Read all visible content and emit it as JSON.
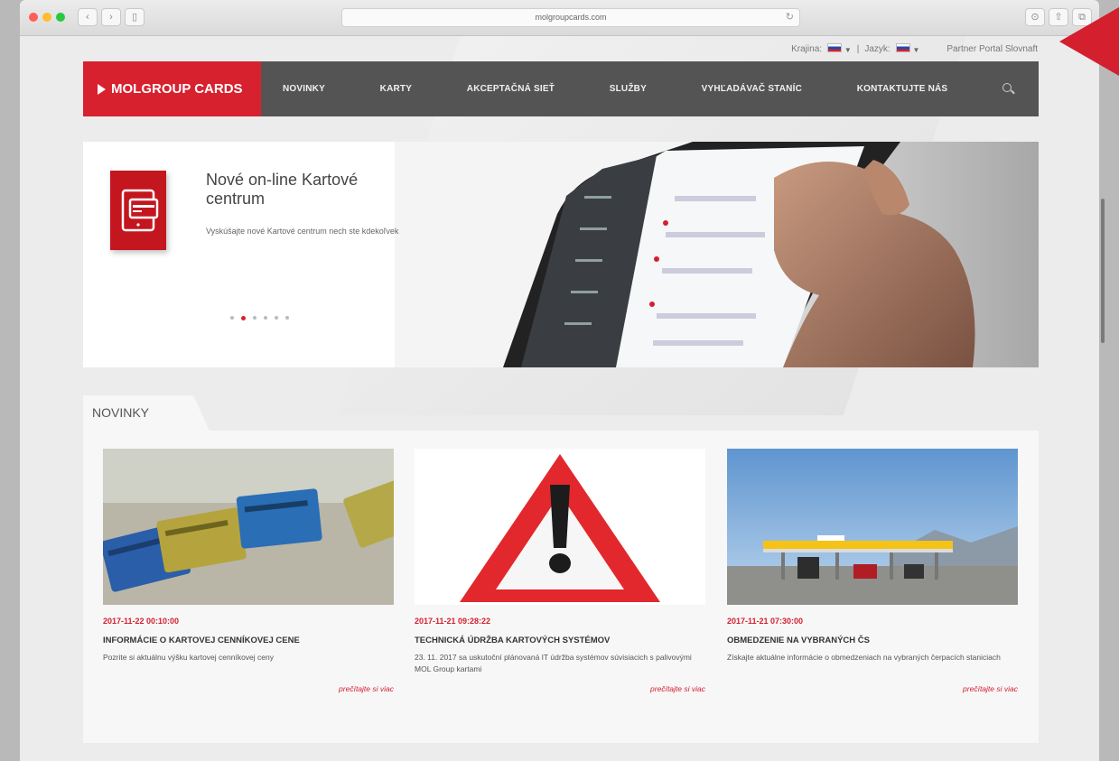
{
  "browser": {
    "url": "molgroupcards.com",
    "dot_colors": [
      "#ff5f57",
      "#febc2e",
      "#28c840"
    ]
  },
  "topbar": {
    "country_label": "Krajina:",
    "separator": "|",
    "language_label": "Jazyk:",
    "portal_link": "Partner Portal Slovnaft"
  },
  "nav": {
    "logo": "MOLGROUP CARDS",
    "items": [
      "NOVINKY",
      "KARTY",
      "AKCEPTAČNÁ SIEŤ",
      "SLUŽBY",
      "VYHĽADÁVAČ STANÍC",
      "KONTAKTUJTE NÁS"
    ]
  },
  "hero": {
    "title": "Nové on-line Kartové centrum",
    "subtitle": "Vyskúšajte nové Kartové centrum nech ste kdekoľvek",
    "slides_total": 6,
    "active_slide": 1
  },
  "news": {
    "heading": "NOVINKY",
    "items": [
      {
        "date": "2017-11-22 00:10:00",
        "title": "INFORMÁCIE O KARTOVEJ CENNÍKOVEJ CENE",
        "text": "Pozrite si aktuálnu výšku kartovej cenníkovej ceny",
        "more": "prečítajte si viac"
      },
      {
        "date": "2017-11-21 09:28:22",
        "title": "TECHNICKÁ ÚDRŽBA KARTOVÝCH SYSTÉMOV",
        "text": "23. 11. 2017 sa uskutoční plánovaná IT údržba systémov súvisiacich s palivovými MOL Group kartami",
        "more": "prečítajte si viac"
      },
      {
        "date": "2017-11-21 07:30:00",
        "title": "OBMEDZENIE NA VYBRANÝCH ČS",
        "text": "Získajte aktuálne informácie o obmedzeniach na vybraných čerpacích staniciach",
        "more": "prečítajte si viac"
      }
    ]
  },
  "colors": {
    "accent": "#d7212f",
    "nav": "#545454"
  }
}
